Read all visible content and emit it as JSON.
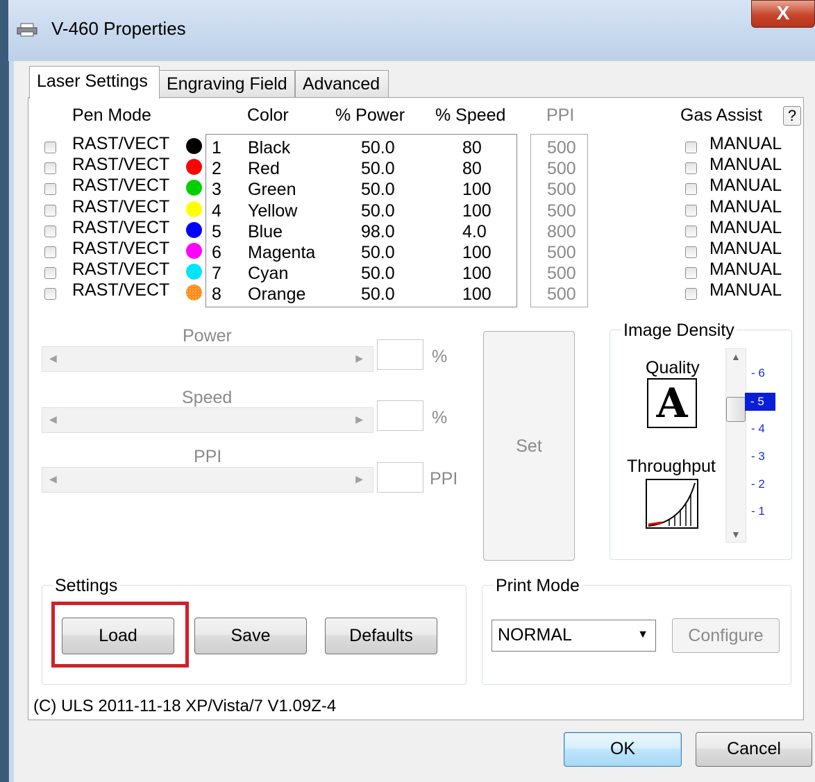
{
  "window": {
    "title": "V-460 Properties",
    "close_label": "X"
  },
  "tabs": [
    {
      "label": "Laser Settings",
      "active": true
    },
    {
      "label": "Engraving Field",
      "active": false
    },
    {
      "label": "Advanced",
      "active": false
    }
  ],
  "headers": {
    "pen_mode": "Pen Mode",
    "color": "Color",
    "power": "% Power",
    "speed": "% Speed",
    "ppi": "PPI",
    "gas_assist": "Gas Assist",
    "help": "?"
  },
  "pens": [
    {
      "mode": "RAST/VECT",
      "num": "1",
      "color": "Black",
      "power": "50.0",
      "speed": "80",
      "ppi": "500",
      "gas": "MANUAL",
      "swatch": "#000000"
    },
    {
      "mode": "RAST/VECT",
      "num": "2",
      "color": "Red",
      "power": "50.0",
      "speed": "80",
      "ppi": "500",
      "gas": "MANUAL",
      "swatch": "#ff0000"
    },
    {
      "mode": "RAST/VECT",
      "num": "3",
      "color": "Green",
      "power": "50.0",
      "speed": "100",
      "ppi": "500",
      "gas": "MANUAL",
      "swatch": "#00d000"
    },
    {
      "mode": "RAST/VECT",
      "num": "4",
      "color": "Yellow",
      "power": "50.0",
      "speed": "100",
      "ppi": "500",
      "gas": "MANUAL",
      "swatch": "#ffff00"
    },
    {
      "mode": "RAST/VECT",
      "num": "5",
      "color": "Blue",
      "power": "98.0",
      "speed": "4.0",
      "ppi": "800",
      "gas": "MANUAL",
      "swatch": "#0000ff"
    },
    {
      "mode": "RAST/VECT",
      "num": "6",
      "color": "Magenta",
      "power": "50.0",
      "speed": "100",
      "ppi": "500",
      "gas": "MANUAL",
      "swatch": "#ff00ff"
    },
    {
      "mode": "RAST/VECT",
      "num": "7",
      "color": "Cyan",
      "power": "50.0",
      "speed": "100",
      "ppi": "500",
      "gas": "MANUAL",
      "swatch": "#00e5ff"
    },
    {
      "mode": "RAST/VECT",
      "num": "8",
      "color": "Orange",
      "power": "50.0",
      "speed": "100",
      "ppi": "500",
      "gas": "MANUAL",
      "swatch": "#ff8c1a"
    }
  ],
  "sliders": {
    "power_label": "Power",
    "power_unit": "%",
    "speed_label": "Speed",
    "speed_unit": "%",
    "ppi_label": "PPI",
    "ppi_unit": "PPI"
  },
  "set_label": "Set",
  "image_density": {
    "label": "Image Density",
    "quality_label": "Quality",
    "throughput_label": "Throughput",
    "quality_glyph": "A",
    "levels": [
      "- 6",
      "- 5",
      "- 4",
      "- 3",
      "- 2",
      "- 1"
    ],
    "selected": "- 5"
  },
  "settings": {
    "label": "Settings",
    "load": "Load",
    "save": "Save",
    "defaults": "Defaults"
  },
  "print_mode": {
    "label": "Print Mode",
    "value": "NORMAL",
    "configure": "Configure"
  },
  "footer": {
    "version": "(C) ULS 2011-11-18 XP/Vista/7 V1.09Z-4"
  },
  "buttons": {
    "ok": "OK",
    "cancel": "Cancel"
  },
  "colors": {
    "highlight": "#d0202a",
    "selected_level_bg": "#0a1ed8"
  }
}
